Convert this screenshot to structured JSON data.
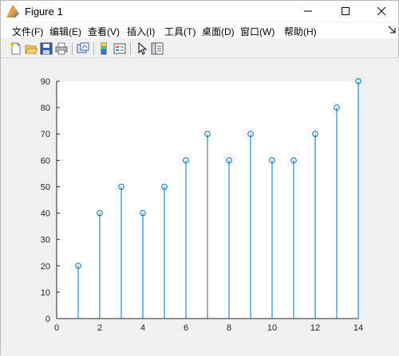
{
  "window": {
    "title": "Figure 1"
  },
  "menu": {
    "items": [
      "文件(F)",
      "编辑(E)",
      "查看(V)",
      "插入(I)",
      "工具(T)",
      "桌面(D)",
      "窗口(W)",
      "帮助(H)"
    ]
  },
  "toolbar": {
    "buttons": [
      "new-figure-icon",
      "open-file-icon",
      "save-icon",
      "print-icon",
      "link-figure-icon",
      "insert-colorbar-icon",
      "insert-legend-icon",
      "select-arrow-icon",
      "property-inspector-icon"
    ]
  },
  "colors": {
    "stem": "#0072bd",
    "axis": "#262626",
    "window_bg": "#f0f0f0"
  },
  "chart_data": {
    "type": "stem",
    "x": [
      1,
      2,
      3,
      4,
      5,
      6,
      7,
      8,
      9,
      10,
      11,
      12,
      13,
      14
    ],
    "y": [
      20,
      40,
      50,
      40,
      50,
      60,
      70,
      60,
      70,
      60,
      60,
      70,
      80,
      90
    ],
    "xlim": [
      0,
      14
    ],
    "ylim": [
      0,
      90
    ],
    "xticks": [
      "0",
      "2",
      "4",
      "6",
      "8",
      "10",
      "12",
      "14"
    ],
    "yticks": [
      "0",
      "10",
      "20",
      "30",
      "40",
      "50",
      "60",
      "70",
      "80",
      "90"
    ],
    "title": "",
    "xlabel": "",
    "ylabel": "",
    "grid": false,
    "marker": "open-circle"
  }
}
